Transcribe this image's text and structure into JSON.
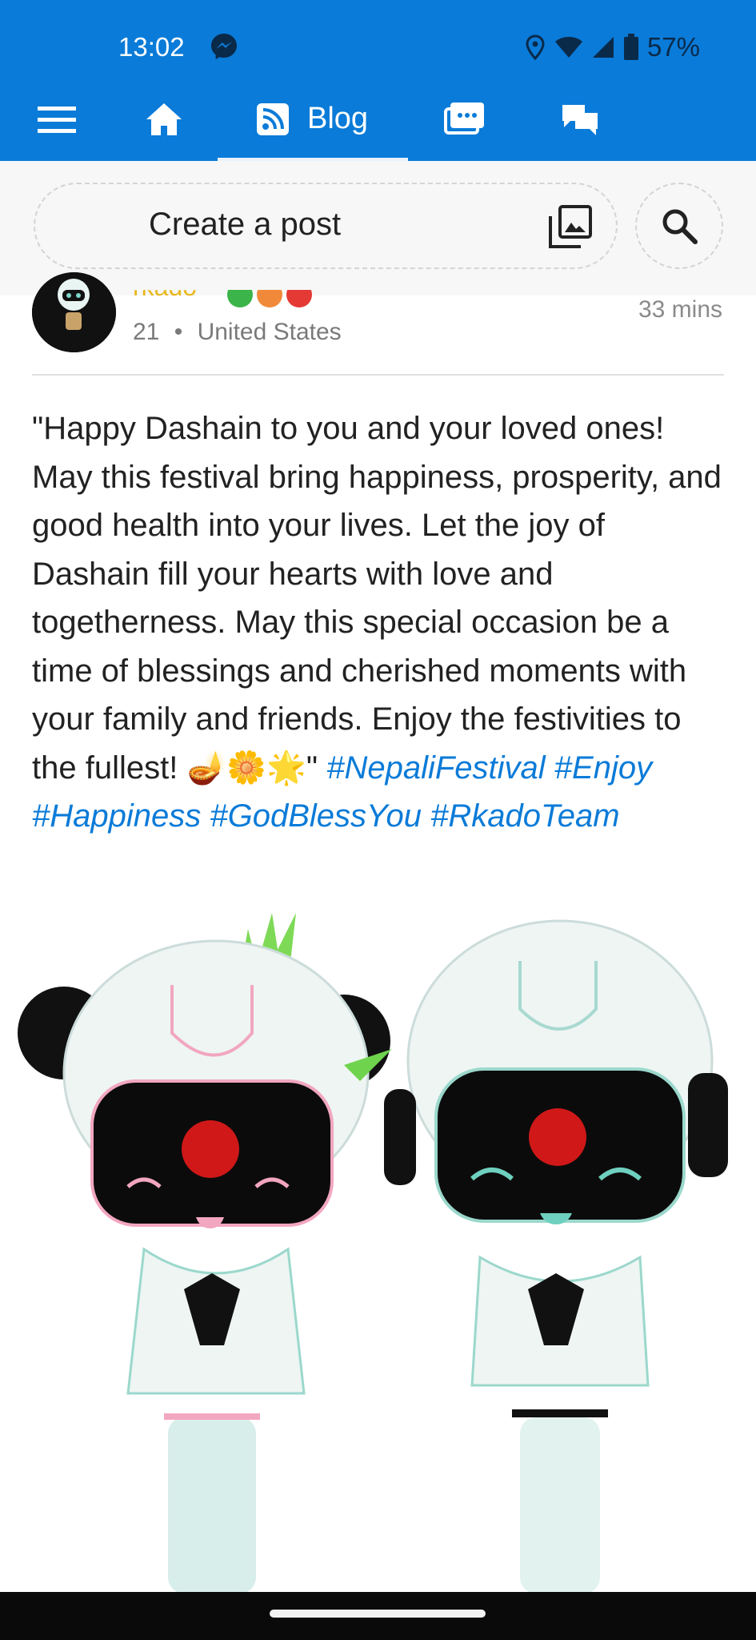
{
  "status_bar": {
    "time": "13:02",
    "battery_percent": "57%",
    "icons": [
      "messenger-icon",
      "location-icon",
      "wifi-icon",
      "signal-icon",
      "battery-icon"
    ]
  },
  "nav": {
    "blog_label": "Blog",
    "icons": [
      "menu-icon",
      "home-icon",
      "blog-icon",
      "gallery-chat-icon",
      "chat-icon"
    ]
  },
  "composer": {
    "placeholder": "Create a post"
  },
  "post": {
    "username_fragment": "rkado",
    "age": "21",
    "separator": "•",
    "location": "United States",
    "time_ago": "33 mins",
    "text": "\"Happy Dashain to you and your loved ones! May this festival bring happiness, prosperity, and good health into your lives. Let the joy of Dashain fill your hearts with love and togetherness. May this special occasion be a time of blessings and cherished moments with your family and friends. Enjoy the festivities to the fullest!",
    "emoji": "🪔🌼🌟\"",
    "hashtags": "#NepaliFestival #Enjoy #Happiness #GodBlessYou #RkadoTeam"
  },
  "colors": {
    "brand": "#0a7bd8",
    "hashtag": "#0a7bd8",
    "meta_text": "#7a7a7a"
  }
}
